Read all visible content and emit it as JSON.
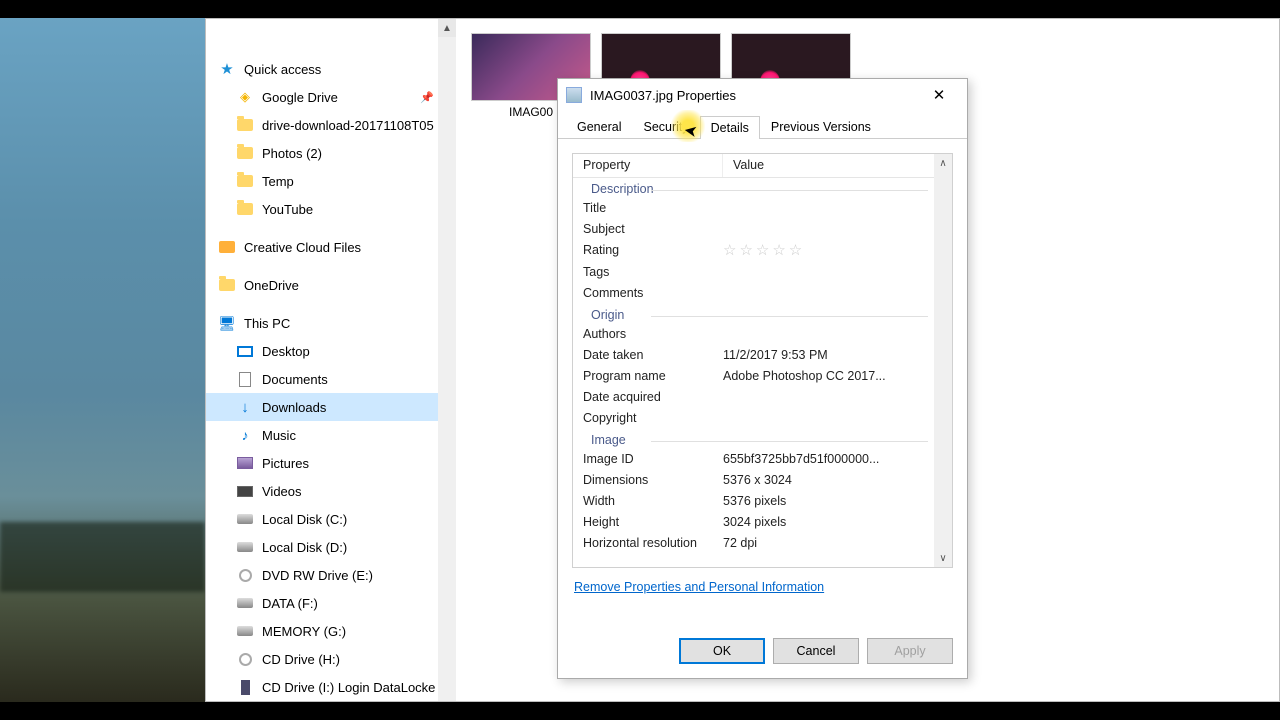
{
  "nav": {
    "quick_access": "Quick access",
    "items_qa": [
      {
        "label": "Google Drive",
        "icon": "gd-ico",
        "pinned": true
      },
      {
        "label": "drive-download-20171108T05",
        "icon": "folder-y"
      },
      {
        "label": "Photos (2)",
        "icon": "folder-y"
      },
      {
        "label": "Temp",
        "icon": "folder-y"
      },
      {
        "label": "YouTube",
        "icon": "folder-y"
      }
    ],
    "creative_cloud": "Creative Cloud Files",
    "onedrive": "OneDrive",
    "this_pc": "This PC",
    "items_pc": [
      {
        "label": "Desktop",
        "icon": "mon-ico"
      },
      {
        "label": "Documents",
        "icon": "doc-ico"
      },
      {
        "label": "Downloads",
        "icon": "dl-ico",
        "selected": true
      },
      {
        "label": "Music",
        "icon": "mus-ico"
      },
      {
        "label": "Pictures",
        "icon": "pic-ico"
      },
      {
        "label": "Videos",
        "icon": "vid-ico"
      },
      {
        "label": "Local Disk (C:)",
        "icon": "disk-ico"
      },
      {
        "label": "Local Disk (D:)",
        "icon": "disk-ico"
      },
      {
        "label": "DVD RW Drive (E:)",
        "icon": "dvd-ico"
      },
      {
        "label": "DATA (F:)",
        "icon": "disk-ico"
      },
      {
        "label": "MEMORY (G:)",
        "icon": "disk-ico"
      },
      {
        "label": "CD Drive (H:)",
        "icon": "dvd-ico"
      },
      {
        "label": "CD Drive (I:) Login DataLocke",
        "icon": "usb-ico"
      }
    ]
  },
  "thumbs": [
    {
      "caption": "IMAG00"
    },
    {
      "caption": ""
    },
    {
      "caption": ""
    }
  ],
  "dialog": {
    "title": "IMAG0037.jpg Properties",
    "tabs": [
      "General",
      "Security",
      "Details",
      "Previous Versions"
    ],
    "active_tab": "Details",
    "grid_headers": {
      "property": "Property",
      "value": "Value"
    },
    "sections": [
      {
        "name": "Description",
        "rows": [
          {
            "k": "Title",
            "v": ""
          },
          {
            "k": "Subject",
            "v": ""
          },
          {
            "k": "Rating",
            "v": "★★★★★",
            "stars": true
          },
          {
            "k": "Tags",
            "v": ""
          },
          {
            "k": "Comments",
            "v": ""
          }
        ]
      },
      {
        "name": "Origin",
        "rows": [
          {
            "k": "Authors",
            "v": ""
          },
          {
            "k": "Date taken",
            "v": "11/2/2017 9:53 PM"
          },
          {
            "k": "Program name",
            "v": "Adobe Photoshop CC 2017..."
          },
          {
            "k": "Date acquired",
            "v": ""
          },
          {
            "k": "Copyright",
            "v": ""
          }
        ]
      },
      {
        "name": "Image",
        "rows": [
          {
            "k": "Image ID",
            "v": "655bf3725bb7d51f000000..."
          },
          {
            "k": "Dimensions",
            "v": "5376 x 3024"
          },
          {
            "k": "Width",
            "v": "5376 pixels"
          },
          {
            "k": "Height",
            "v": "3024 pixels"
          },
          {
            "k": "Horizontal resolution",
            "v": "72 dpi"
          }
        ]
      }
    ],
    "remove_link": "Remove Properties and Personal Information",
    "buttons": {
      "ok": "OK",
      "cancel": "Cancel",
      "apply": "Apply"
    }
  }
}
